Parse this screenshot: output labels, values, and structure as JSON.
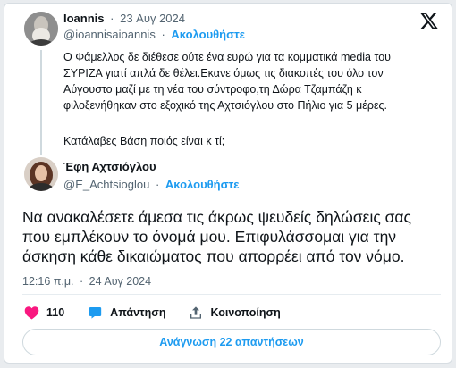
{
  "quoted_post": {
    "author_name": "Ioannis",
    "date": "23 Αυγ 2024",
    "handle": "@ioannisaioannis",
    "follow_label": "Ακολουθήστε",
    "text_lines": [
      "Ο Φάμελλος δε διέθεσε ούτε ένα ευρώ για τα κομματικά media του",
      "ΣΥΡΙΖΑ γιατί απλά δε θέλει.Εκανε όμως τις διακοπές του όλο τον",
      "Αύγουστο μαζί με τη νέα του σύντροφο,τη Δώρα Τζαμπάζη κ",
      "φιλοξενήθηκαν στο εξοχικό της Αχτσιόγλου στο Πήλιο για 5 μέρες."
    ],
    "text_extra": "Κατάλαβες Βάση ποιός είναι κ τί;"
  },
  "main_post": {
    "author_name": "Έφη Αχτσιόγλου",
    "handle": "@E_Achtsioglou",
    "follow_label": "Ακολουθήστε",
    "text_lines": [
      "Να ανακαλέσετε άμεσα τις άκρως ψευδείς δηλώσεις σας",
      "που εμπλέκουν το όνομά μου. Επιφυλάσσομαι για την",
      "άσκηση κάθε δικαιώματος που απορρέει από τον νόμο."
    ],
    "time": "12:16 π.μ.",
    "date": "24 Αυγ 2024"
  },
  "separator": "·",
  "actions": {
    "likes_count": "110",
    "reply_label": "Απάντηση",
    "share_label": "Κοινοποίηση"
  },
  "replies_button_label": "Ανάγνωση 22 απαντήσεων",
  "colors": {
    "accent": "#1d9bf0",
    "like": "#f91880",
    "text_primary": "#0f1419",
    "text_secondary": "#536471"
  },
  "icons": [
    "x-logo-icon",
    "heart-icon",
    "reply-icon",
    "share-icon"
  ]
}
